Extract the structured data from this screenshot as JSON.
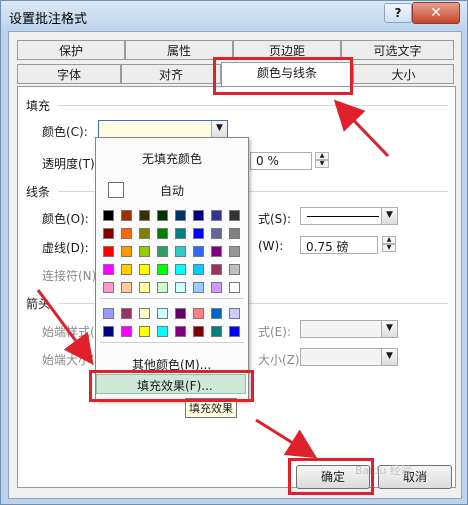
{
  "window": {
    "title": "设置批注格式",
    "help_glyph": "?",
    "close_glyph": "✕"
  },
  "tabs_row1": [
    "保护",
    "属性",
    "页边距",
    "可选文字"
  ],
  "tabs_row2": [
    "字体",
    "对齐",
    "颜色与线条",
    "大小"
  ],
  "fill": {
    "section": "填充",
    "color_label": "颜色(C):",
    "transparency_label": "透明度(T):",
    "transparency_value": "0 %",
    "color_value_hex": "#fffde0"
  },
  "line": {
    "section": "线条",
    "color_label": "颜色(O):",
    "style_label_fragment": "式(S):",
    "dash_label": "虚线(D):",
    "weight_label_fragment": "(W):",
    "weight_value": "0.75 磅",
    "connector_label": "连接符(N):"
  },
  "arrows": {
    "section": "箭头",
    "begin_style": "始端样式(B)",
    "begin_size": "始端大小(I):",
    "end_style_fragment": "式(E):",
    "end_size_fragment": "大小(Z):"
  },
  "color_popup": {
    "no_fill": "无填充颜色",
    "automatic": "自动",
    "more_colors": "其他颜色(M)...",
    "fill_effects": "填充效果(F)...",
    "palette": [
      [
        "#000000",
        "#993300",
        "#333300",
        "#003300",
        "#003366",
        "#000080",
        "#333399",
        "#333333"
      ],
      [
        "#800000",
        "#ff6600",
        "#808000",
        "#008000",
        "#008080",
        "#0000ff",
        "#666699",
        "#808080"
      ],
      [
        "#ff0000",
        "#ff9900",
        "#99cc00",
        "#339966",
        "#33cccc",
        "#3366ff",
        "#800080",
        "#969696"
      ],
      [
        "#ff00ff",
        "#ffcc00",
        "#ffff00",
        "#00ff00",
        "#00ffff",
        "#00ccff",
        "#993366",
        "#c0c0c0"
      ],
      [
        "#ff99cc",
        "#ffcc99",
        "#ffff99",
        "#ccffcc",
        "#ccffff",
        "#99ccff",
        "#cc99ff",
        "#ffffff"
      ]
    ],
    "chart_palette": [
      [
        "#9999ff",
        "#993366",
        "#ffffcc",
        "#ccffff",
        "#660066",
        "#ff8080",
        "#0066cc",
        "#ccccff"
      ],
      [
        "#000080",
        "#ff00ff",
        "#ffff00",
        "#00ffff",
        "#800080",
        "#800000",
        "#008080",
        "#0000ff"
      ]
    ]
  },
  "tooltip": "填充效果",
  "buttons": {
    "ok": "确定",
    "cancel": "取消"
  },
  "watermark": "Baidu 经验",
  "accent_red": "#e0202a"
}
